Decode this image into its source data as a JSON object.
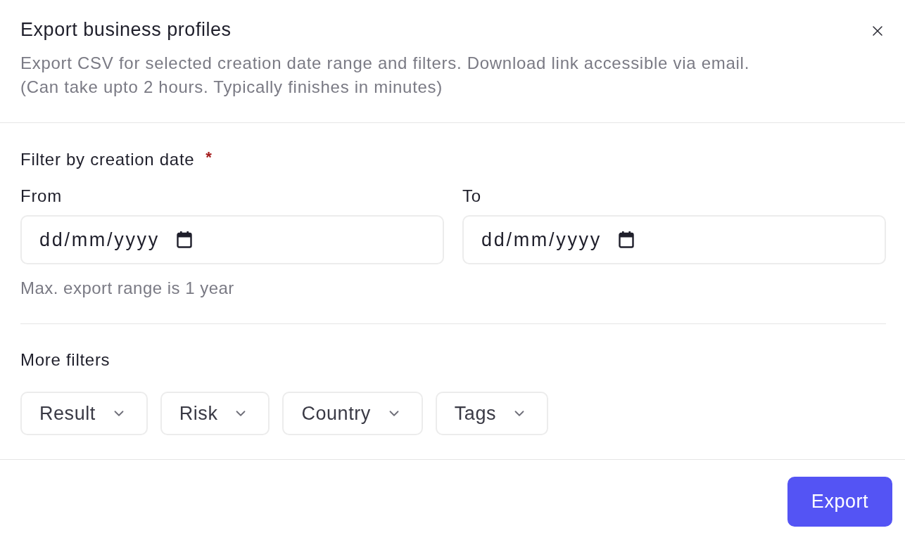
{
  "dialog": {
    "title": "Export business profiles",
    "description": [
      "Export CSV for selected creation date range and filters. Download link accessible via email.",
      "(Can take upto 2 hours. Typically finishes in minutes)"
    ]
  },
  "date_filter": {
    "label": "Filter by creation date",
    "required_mark": "*",
    "fields": [
      {
        "label": "From",
        "placeholder": "dd/mm/yyyy"
      },
      {
        "label": "To",
        "placeholder": "dd/mm/yyyy"
      }
    ],
    "hint": "Max. export range is 1 year"
  },
  "more_filters": {
    "label": "More filters",
    "filters": [
      "Result",
      "Risk",
      "Country",
      "Tags"
    ]
  },
  "footer": {
    "button": "Export"
  }
}
